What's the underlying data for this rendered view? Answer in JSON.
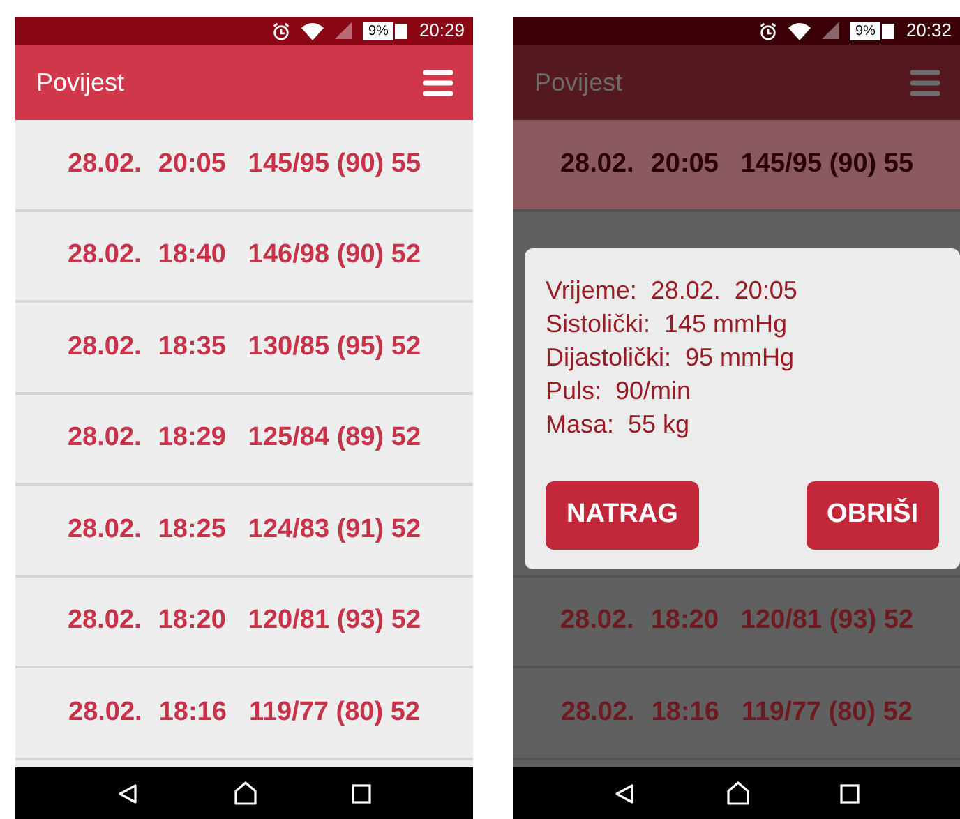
{
  "screens": [
    {
      "dimmed": false,
      "status_bar": {
        "battery": "9%",
        "time": "20:29"
      },
      "app_bar": {
        "title": "Povijest"
      },
      "rows": [
        {
          "date": "28.02.",
          "time": "20:05",
          "reading": "145/95 (90) 55",
          "selected": false
        },
        {
          "date": "28.02.",
          "time": "18:40",
          "reading": "146/98 (90) 52",
          "selected": false
        },
        {
          "date": "28.02.",
          "time": "18:35",
          "reading": "130/85 (95) 52",
          "selected": false
        },
        {
          "date": "28.02.",
          "time": "18:29",
          "reading": "125/84 (89) 52",
          "selected": false
        },
        {
          "date": "28.02.",
          "time": "18:25",
          "reading": "124/83 (91) 52",
          "selected": false
        },
        {
          "date": "28.02.",
          "time": "18:20",
          "reading": "120/81 (93) 52",
          "selected": false
        },
        {
          "date": "28.02.",
          "time": "18:16",
          "reading": "119/77 (80) 52",
          "selected": false
        }
      ]
    },
    {
      "dimmed": true,
      "status_bar": {
        "battery": "9%",
        "time": "20:32"
      },
      "app_bar": {
        "title": "Povijest"
      },
      "rows": [
        {
          "date": "28.02.",
          "time": "20:05",
          "reading": "145/95 (90) 55",
          "selected": true
        },
        {
          "date": "28.02.",
          "time": "18:20",
          "reading": "120/81 (93) 52",
          "selected": false
        },
        {
          "date": "28.02.",
          "time": "18:16",
          "reading": "119/77 (80) 52",
          "selected": false
        }
      ],
      "dialog": {
        "lines": [
          "Vrijeme:  28.02.  20:05",
          "Sistolički:  145 mmHg",
          "Dijastolički:  95 mmHg",
          "Puls:  90/min",
          "Masa:  55 kg"
        ],
        "buttons": [
          "NATRAG",
          "OBRIŠI"
        ]
      }
    }
  ]
}
